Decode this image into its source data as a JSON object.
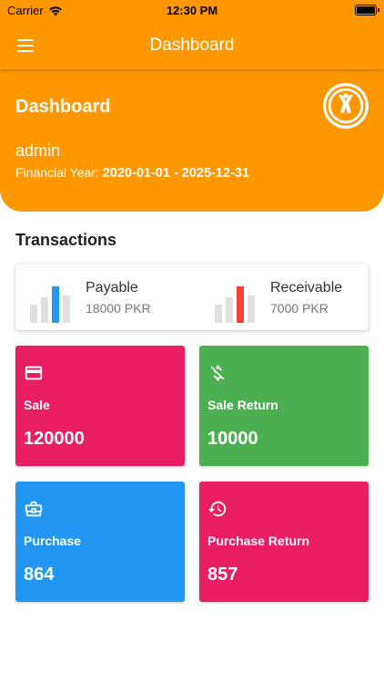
{
  "status_bar": {
    "carrier": "Carrier",
    "time": "12:30 PM"
  },
  "app_bar": {
    "title": "Dashboard"
  },
  "header": {
    "title": "Dashboard",
    "username": "admin",
    "financial_year_label": "Financial Year: ",
    "financial_year_value": "2020-01-01 - 2025-12-31"
  },
  "transactions": {
    "title": "Transactions",
    "payable": {
      "label": "Payable",
      "value": "18000 PKR",
      "accent": "#2196F3"
    },
    "receivable": {
      "label": "Receivable",
      "value": "7000 PKR",
      "accent": "#F44336"
    }
  },
  "tiles": [
    {
      "label": "Sale",
      "value": "120000",
      "color": "#E91E63",
      "icon": "credit-card-icon"
    },
    {
      "label": "Sale Return",
      "value": "10000",
      "color": "#4CAF50",
      "icon": "money-off-icon"
    },
    {
      "label": "Purchase",
      "value": "864",
      "color": "#2196F3",
      "icon": "briefcase-icon"
    },
    {
      "label": "Purchase Return",
      "value": "857",
      "color": "#E91E63",
      "icon": "history-icon"
    }
  ],
  "colors": {
    "primary": "#FF9800",
    "bar_gray": "#E0E0E0"
  }
}
